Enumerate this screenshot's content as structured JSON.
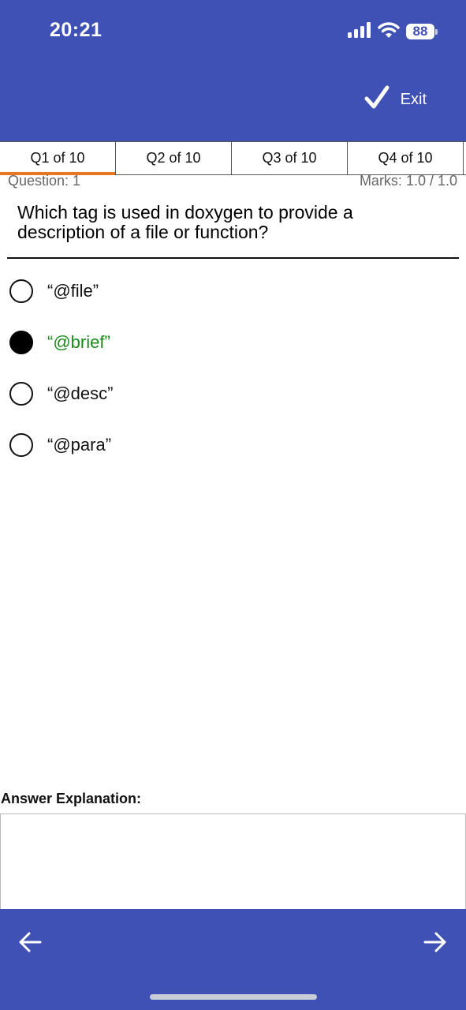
{
  "status_bar": {
    "time": "20:21",
    "battery": "88"
  },
  "header": {
    "exit_label": "Exit"
  },
  "tabs": [
    {
      "label": "Q1 of 10"
    },
    {
      "label": "Q2 of 10"
    },
    {
      "label": "Q3 of 10"
    },
    {
      "label": "Q4 of 10"
    }
  ],
  "question": {
    "number_label": "Question: 1",
    "marks_label": "Marks: 1.0 / 1.0",
    "text": "Which tag is used in doxygen to provide a description of a file or function?"
  },
  "options": [
    {
      "label": "“@file”",
      "selected": false
    },
    {
      "label": "“@brief”",
      "selected": true
    },
    {
      "label": "“@desc”",
      "selected": false
    },
    {
      "label": "“@para”",
      "selected": false
    }
  ],
  "explanation": {
    "title": "Answer Explanation:",
    "text": ""
  },
  "colors": {
    "primary": "#3f51b5",
    "active_tab_indicator": "#e87722",
    "correct_answer": "#1a8a1a"
  },
  "icons": {
    "signal": "signal-icon",
    "wifi": "wifi-icon",
    "exit": "checkmark-icon",
    "prev": "arrow-left-icon",
    "next": "arrow-right-icon"
  }
}
